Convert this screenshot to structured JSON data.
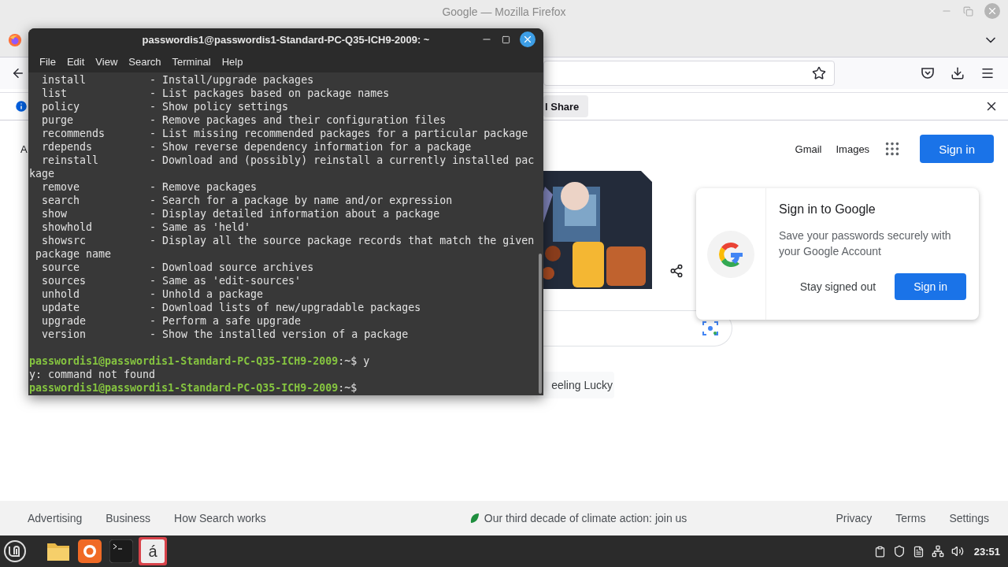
{
  "firefox": {
    "title": "Google — Mozilla Firefox",
    "notification": {
      "button": "l Share"
    },
    "page": {
      "header_left": "A",
      "header_links": [
        "Gmail",
        "Images"
      ],
      "sign_in_button": "Sign in",
      "lucky_button": "eeling Lucky",
      "sign_in_card": {
        "title": "Sign in to Google",
        "text": "Save your passwords securely with your Google Account",
        "dismiss": "Stay signed out",
        "confirm": "Sign in"
      }
    },
    "footer": {
      "left": [
        "Advertising",
        "Business",
        "How Search works"
      ],
      "center": "Our third decade of climate action: join us",
      "right": [
        "Privacy",
        "Terms",
        "Settings"
      ]
    }
  },
  "terminal": {
    "title": "passwordis1@passwordis1-Standard-PC-Q35-ICH9-2009: ~",
    "menu": [
      "File",
      "Edit",
      "View",
      "Search",
      "Terminal",
      "Help"
    ],
    "lines": [
      {
        "kind": "command",
        "name": "install",
        "description": "- Install/upgrade packages"
      },
      {
        "kind": "command",
        "name": "list",
        "description": "- List packages based on package names"
      },
      {
        "kind": "command",
        "name": "policy",
        "description": "- Show policy settings"
      },
      {
        "kind": "command",
        "name": "purge",
        "description": "- Remove packages and their configuration files"
      },
      {
        "kind": "command",
        "name": "recommends",
        "description": "- List missing recommended packages for a particular package"
      },
      {
        "kind": "command",
        "name": "rdepends",
        "description": "- Show reverse dependency information for a package"
      },
      {
        "kind": "command",
        "name": "reinstall",
        "description": "- Download and (possibly) reinstall a currently installed pac"
      },
      {
        "kind": "text",
        "text": "kage"
      },
      {
        "kind": "command",
        "name": "remove",
        "description": "- Remove packages"
      },
      {
        "kind": "command",
        "name": "search",
        "description": "- Search for a package by name and/or expression"
      },
      {
        "kind": "command",
        "name": "show",
        "description": "- Display detailed information about a package"
      },
      {
        "kind": "command",
        "name": "showhold",
        "description": "- Same as 'held'"
      },
      {
        "kind": "command",
        "name": "showsrc",
        "description": "- Display all the source package records that match the given"
      },
      {
        "kind": "text",
        "text": " package name"
      },
      {
        "kind": "command",
        "name": "source",
        "description": "- Download source archives"
      },
      {
        "kind": "command",
        "name": "sources",
        "description": "- Same as 'edit-sources'"
      },
      {
        "kind": "command",
        "name": "unhold",
        "description": "- Unhold a package"
      },
      {
        "kind": "command",
        "name": "update",
        "description": "- Download lists of new/upgradable packages"
      },
      {
        "kind": "command",
        "name": "upgrade",
        "description": "- Perform a safe upgrade"
      },
      {
        "kind": "command",
        "name": "version",
        "description": "- Show the installed version of a package"
      },
      {
        "kind": "blank"
      },
      {
        "kind": "prompt",
        "user": "passwordis1@passwordis1-Standard-PC-Q35-ICH9-2009",
        "path": ":~$",
        "command": "y"
      },
      {
        "kind": "text",
        "text": "y: command not found"
      },
      {
        "kind": "prompt",
        "user": "passwordis1@passwordis1-Standard-PC-Q35-ICH9-2009",
        "path": ":~$"
      }
    ]
  },
  "taskbar": {
    "apps": [
      {
        "kind": "files",
        "selected": false
      },
      {
        "kind": "firefox",
        "selected": false
      },
      {
        "kind": "terminal",
        "selected": false
      },
      {
        "kind": "charmap",
        "label": "á",
        "selected": true
      }
    ],
    "clock": "23:51"
  }
}
